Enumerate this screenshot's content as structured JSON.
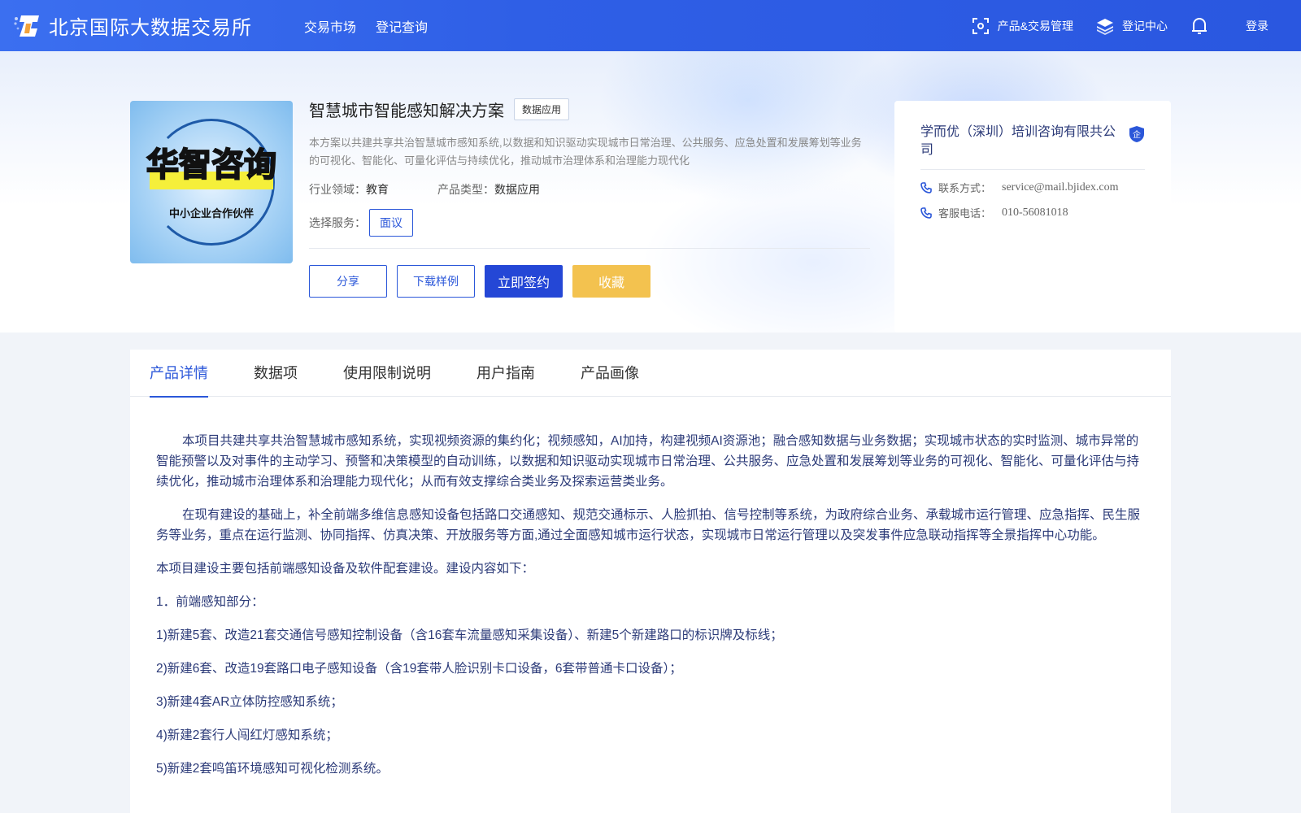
{
  "header": {
    "logo_name": "北京国际大数据交易所",
    "nav": [
      "交易市场",
      "登记查询"
    ],
    "tools": {
      "product_mgmt": "产品&交易管理",
      "register_center": "登记中心",
      "login": "登录"
    }
  },
  "product": {
    "image_text": "华智咨询",
    "image_subtext": "中小企业合作伙伴",
    "title": "智慧城市智能感知解决方案",
    "tag": "数据应用",
    "description": "本方案以共建共享共治智慧城市感知系统,以数据和知识驱动实现城市日常治理、公共服务、应急处置和发展筹划等业务的可视化、智能化、可量化评估与持续优化，推动城市治理体系和治理能力现代化",
    "industry_label": "行业领域：",
    "industry_value": "教育",
    "type_label": "产品类型：",
    "type_value": "数据应用",
    "service_label": "选择服务：",
    "service_option": "面议",
    "buttons": {
      "share": "分享",
      "download": "下载样例",
      "sign": "立即签约",
      "favorite": "收藏"
    }
  },
  "company": {
    "name": "学而优（深圳）培训咨询有限共公司",
    "badge": "企",
    "contact_label": "联系方式：",
    "contact_value": "service@mail.bjidex.com",
    "phone_label": "客服电话：",
    "phone_value": "010-56081018"
  },
  "tabs": [
    "产品详情",
    "数据项",
    "使用限制说明",
    "用户指南",
    "产品画像"
  ],
  "details": {
    "p1": "本项目共建共享共治智慧城市感知系统，实现视频资源的集约化；视频感知，AI加持，构建视频AI资源池；融合感知数据与业务数据；实现城市状态的实时监测、城市异常的智能预警以及对事件的主动学习、预警和决策模型的自动训练，以数据和知识驱动实现城市日常治理、公共服务、应急处置和发展筹划等业务的可视化、智能化、可量化评估与持续优化，推动城市治理体系和治理能力现代化；从而有效支撑综合类业务及探索运营类业务。",
    "p2": "在现有建设的基础上，补全前端多维信息感知设备包括路口交通感知、规范交通标示、人脸抓拍、信号控制等系统，为政府综合业务、承载城市运行管理、应急指挥、民生服务等业务，重点在运行监测、协同指挥、仿真决策、开放服务等方面,通过全面感知城市运行状态，实现城市日常运行管理以及突发事件应急联动指挥等全景指挥中心功能。",
    "p3": "本项目建设主要包括前端感知设备及软件配套建设。建设内容如下：",
    "p4": "1．前端感知部分：",
    "p5": "1)新建5套、改造21套交通信号感知控制设备（含16套车流量感知采集设备）、新建5个新建路口的标识牌及标线；",
    "p6": "2)新建6套、改造19套路口电子感知设备（含19套带人脸识别卡口设备，6套带普通卡口设备）；",
    "p7": "3)新建4套AR立体防控感知系统；",
    "p8": "4)新建2套行人闯红灯感知系统；",
    "p9": "5)新建2套鸣笛环境感知可视化检测系统。"
  }
}
